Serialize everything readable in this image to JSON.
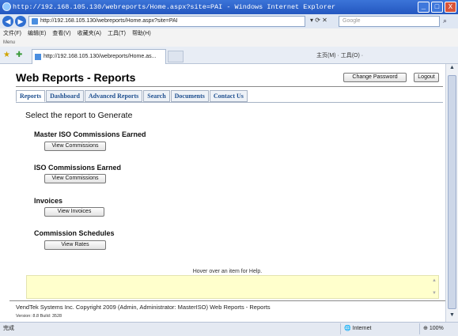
{
  "browser": {
    "window_title": "http://192.168.105.130/webreports/Home.aspx?site=PAI - Windows Internet Explorer",
    "address": "http://192.168.105.130/webreports/Home.aspx?site=PAI",
    "search_placeholder": "Google",
    "menu": [
      "文件(F)",
      "编辑(E)",
      "查看(V)",
      "收藏夹(A)",
      "工具(T)",
      "帮助(H)"
    ],
    "links_label": "Menu",
    "tab_title": "http://192.168.105.130/webreports/Home.as...",
    "command_bar": "主页(M) · 工具(O) ·",
    "status_left": "完成",
    "zone": "Internet",
    "zoom": "100%",
    "window_buttons": {
      "minimize": "_",
      "maximize": "□",
      "close": "X"
    }
  },
  "app": {
    "title": "Web Reports - Reports",
    "change_password": "Change Password",
    "logout": "Logout",
    "tabs": [
      "Reports",
      "Dashboard",
      "Advanced Reports",
      "Search",
      "Documents",
      "Contact Us"
    ],
    "prompt": "Select the report to Generate",
    "sections": [
      {
        "title": "Master ISO Commissions Earned",
        "button": "View Commissions"
      },
      {
        "title": "ISO Commissions Earned",
        "button": "View Commissions"
      },
      {
        "title": "Invoices",
        "button": "View Invoices"
      },
      {
        "title": "Commission Schedules",
        "button": "View Rates"
      }
    ],
    "help_text": "Hover over an item for Help.",
    "footer": "VendTek Systems Inc. Copyright 2009 (Admin, Administrator: MasterISO) Web Reports - Reports",
    "version": "Version: 8.8 Build: 3528"
  }
}
